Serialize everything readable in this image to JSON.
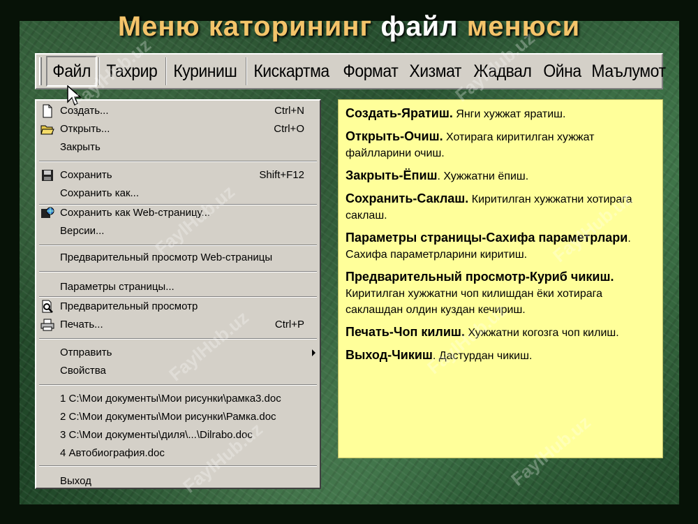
{
  "title": {
    "part1": "Меню  каторининг",
    "part2": "файл",
    "part3": "менюси"
  },
  "menubar": {
    "items": [
      {
        "label": "Файл"
      },
      {
        "label": "Тахрир"
      },
      {
        "label": "Куриниш"
      },
      {
        "label": "Кискартма"
      },
      {
        "label": "Формат"
      },
      {
        "label": "Хизмат"
      },
      {
        "label": "Жадвал"
      },
      {
        "label": "Ойна"
      },
      {
        "label": "Маълумот"
      }
    ]
  },
  "file_menu": {
    "items": [
      {
        "label": "Создать...",
        "shortcut": "Ctrl+N",
        "icon": "new-document-icon"
      },
      {
        "label": "Открыть...",
        "shortcut": "Ctrl+O",
        "icon": "open-folder-icon"
      },
      {
        "label": "Закрыть",
        "shortcut": ""
      },
      {
        "label": "Сохранить",
        "shortcut": "Shift+F12",
        "icon": "save-disk-icon"
      },
      {
        "label": "Сохранить как...",
        "shortcut": ""
      },
      {
        "label": "Сохранить как Web-страницу...",
        "shortcut": "",
        "icon": "web-save-icon"
      },
      {
        "label": "Версии...",
        "shortcut": ""
      },
      {
        "label": "Предварительный просмотр Web-страницы",
        "shortcut": ""
      },
      {
        "label": "Параметры страницы...",
        "shortcut": ""
      },
      {
        "label": "Предварительный просмотр",
        "shortcut": "",
        "icon": "print-preview-icon"
      },
      {
        "label": "Печать...",
        "shortcut": "Ctrl+P",
        "icon": "printer-icon"
      },
      {
        "label": "Отправить",
        "shortcut": ""
      },
      {
        "label": "Свойства",
        "shortcut": ""
      },
      {
        "label": "1 C:\\Мои документы\\Мои рисунки\\рамка3.doc",
        "shortcut": ""
      },
      {
        "label": "2 C:\\Мои документы\\Мои рисунки\\Рамка.doc",
        "shortcut": ""
      },
      {
        "label": "3 C:\\Мои документы\\диля\\...\\Dilrabo.doc",
        "shortcut": ""
      },
      {
        "label": "4 Автобиография.doc",
        "shortcut": ""
      },
      {
        "label": "Выход",
        "shortcut": ""
      }
    ]
  },
  "info": {
    "paras": [
      {
        "head": "Создать-Яратиш.",
        "body": "  Янги  хужжат  яратиш."
      },
      {
        "head": "Открыть-Очиш.",
        "body": " Хотирага  киритилган  хужжат  файлларини  очиш."
      },
      {
        "head": "Закрыть-Ёпиш",
        "body": ". Хужжатни ёпиш."
      },
      {
        "head": "Сохранить-Саклаш.",
        "body": "  Киритилган  хужжатни  хотирага  саклаш."
      },
      {
        "head": "Параметры страницы-Сахифа параметрлари",
        "body": ". Сахифа  параметрларини  киритиш."
      },
      {
        "head": "Предварительный просмотр-Куриб чикиш.",
        "body": " Киритилган  хужжатни  чоп килишдан ёки хотирага саклашдан олдин куздан кечириш."
      },
      {
        "head": "Печать-Чоп килиш.",
        "body": "  Хужжатни  когозга  чоп  килиш."
      },
      {
        "head": "Выход-Чикиш",
        "body": ".  Дастурдан  чикиш."
      }
    ]
  },
  "watermark": "FaylHub.uz",
  "colors": {
    "title_accent": "#f4c46a",
    "info_bg": "#ffff9a",
    "menu_bg": "#d4d0c8"
  }
}
